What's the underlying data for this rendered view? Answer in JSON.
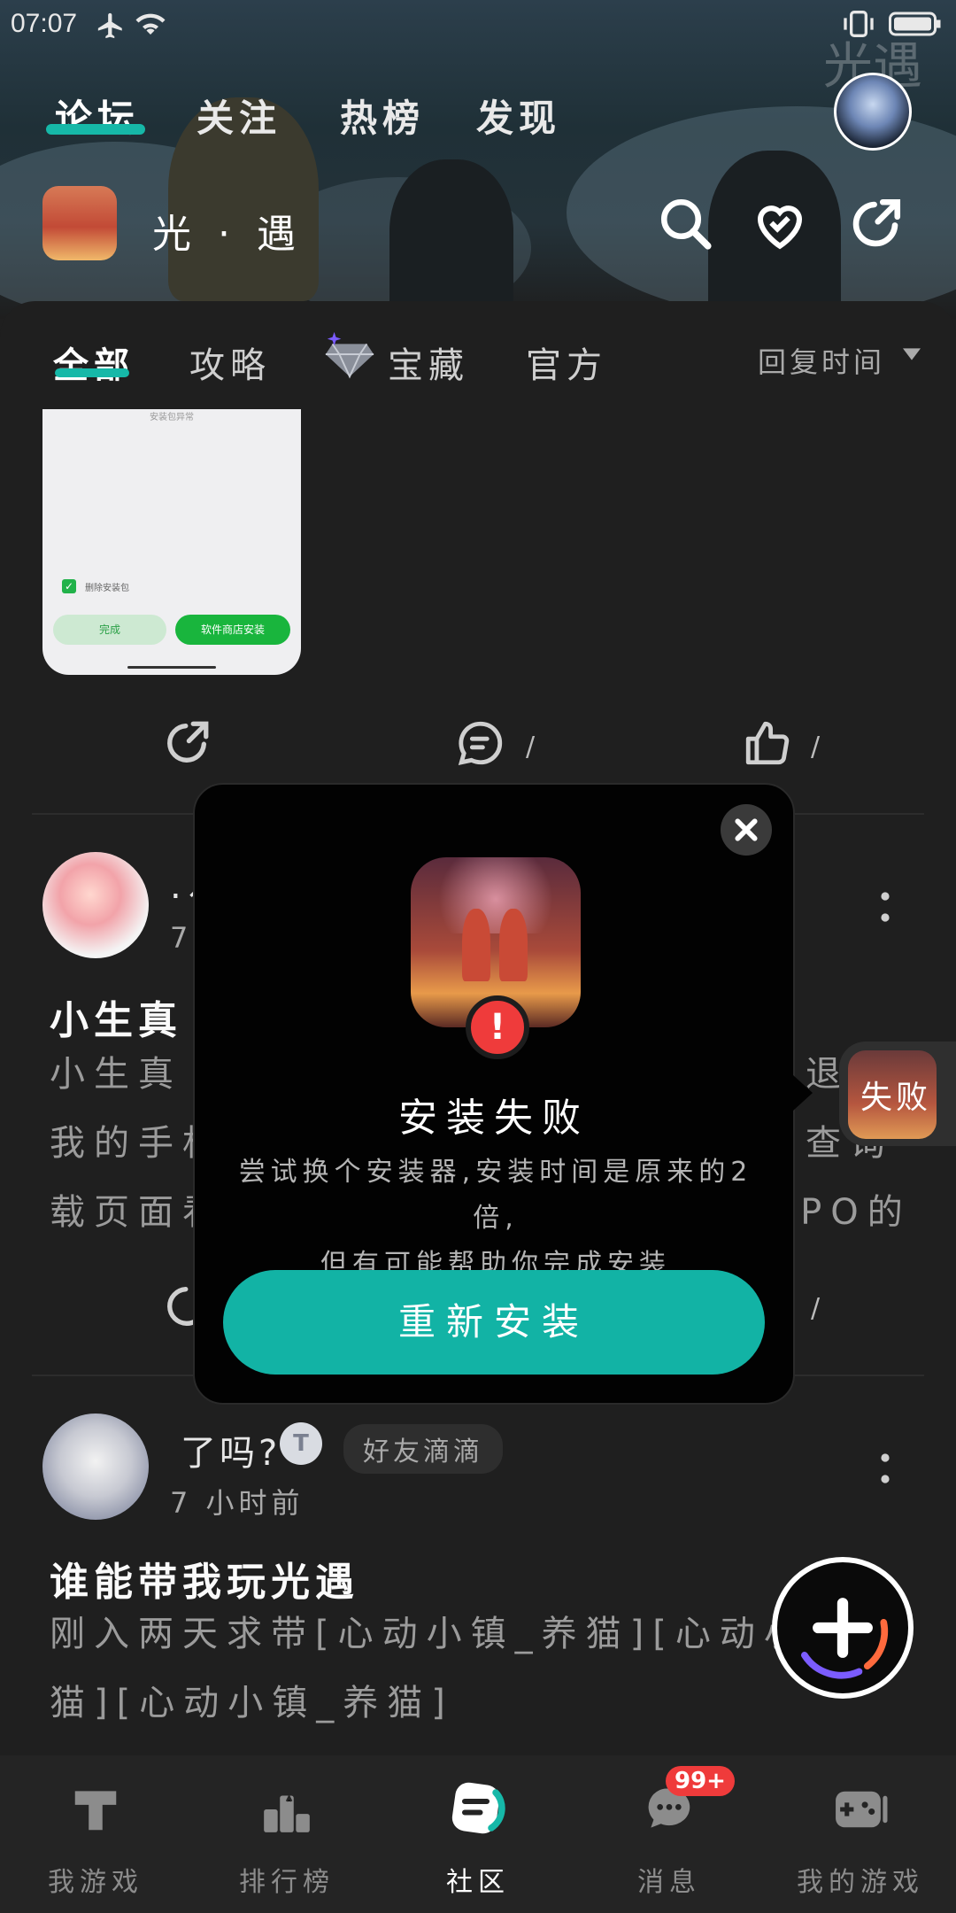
{
  "status_bar": {
    "time": "07:07"
  },
  "header": {
    "watermark": "光遇",
    "top_tabs": [
      {
        "label": "论坛",
        "active": true
      },
      {
        "label": "关注",
        "active": false
      },
      {
        "label": "热榜",
        "active": false
      },
      {
        "label": "发现",
        "active": false
      }
    ],
    "game_name": "光 · 遇"
  },
  "sub_tabs": [
    {
      "label": "全部",
      "active": true
    },
    {
      "label": "攻略",
      "active": false
    },
    {
      "label": "宝藏",
      "active": false
    },
    {
      "label": "官方",
      "active": false
    }
  ],
  "sort_label": "回复时间",
  "first_post": {
    "screenshot": {
      "checkbox_label": "删除安装包",
      "btn_done": "完成",
      "btn_store": "软件商店安装",
      "heading": "安装包异常"
    },
    "comment_count": "/",
    "like_count": "/"
  },
  "second_post": {
    "name": ".↗",
    "time": "7",
    "title": "小生真",
    "lines": [
      "小生真",
      "我的手机",
      "载页面看"
    ],
    "right_lines": [
      "退",
      "查询",
      "PPO的"
    ],
    "like_count": "/"
  },
  "third_post": {
    "name": "了吗?",
    "badge": "好友滴滴",
    "time": "7 小时前",
    "title": "谁能带我玩光遇",
    "lines": [
      "刚入两天求带[心动小镇_养猫][心动小镇_养",
      "猫][心动小镇_养猫]"
    ]
  },
  "modal": {
    "title": "安装失败",
    "desc_line1": "尝试换个安装器,安装时间是原来的2倍,",
    "desc_line2": "但有可能帮助你完成安装",
    "button": "重新安装"
  },
  "side_chip": {
    "label": "失败"
  },
  "bottom_nav": [
    {
      "label": "我游戏",
      "icon": "game-t-icon",
      "active": false
    },
    {
      "label": "排行榜",
      "icon": "podium-icon",
      "active": false
    },
    {
      "label": "社区",
      "icon": "community-icon",
      "active": true
    },
    {
      "label": "消息",
      "icon": "message-icon",
      "active": false,
      "badge": "99+"
    },
    {
      "label": "我的游戏",
      "icon": "gamepad-icon",
      "active": false
    }
  ],
  "colors": {
    "accent": "#16b8a8",
    "error": "#ef3b3b",
    "background": "#1f1f1f"
  }
}
